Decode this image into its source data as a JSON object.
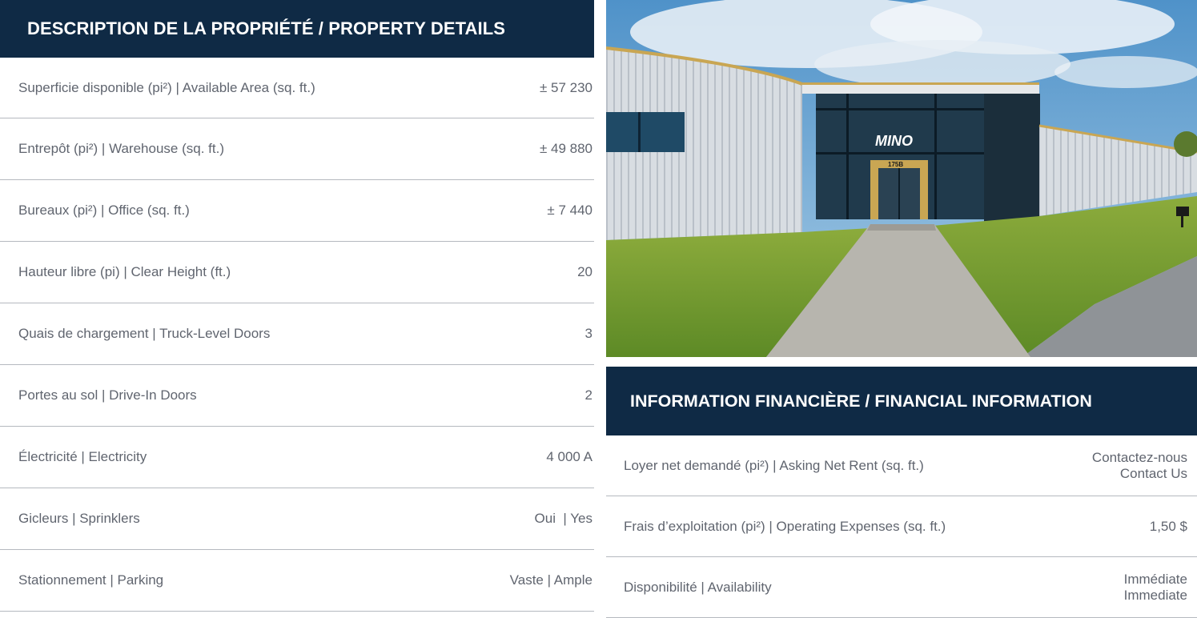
{
  "property": {
    "title": "DESCRIPTION DE LA PROPRIÉTÉ / PROPERTY DETAILS",
    "rows": [
      {
        "label": "Superficie disponible (pi²) | Available Area (sq. ft.)",
        "value": "± 57 230"
      },
      {
        "label": "Entrepôt (pi²) | Warehouse (sq. ft.)",
        "value": "± 49 880"
      },
      {
        "label": "Bureaux (pi²) | Office (sq. ft.)",
        "value": "± 7 440"
      },
      {
        "label": "Hauteur libre (pi) | Clear Height (ft.)",
        "value": "20"
      },
      {
        "label": "Quais de chargement | Truck-Level Doors",
        "value": "3"
      },
      {
        "label": "Portes au sol | Drive-In Doors",
        "value": "2"
      },
      {
        "label": "Électricité | Electricity",
        "value": "4 000 A"
      },
      {
        "label": "Gicleurs | Sprinklers",
        "value": "Oui  | Yes"
      },
      {
        "label": "Stationnement | Parking",
        "value": "Vaste | Ample"
      }
    ]
  },
  "photo": {
    "sign_text": "MINO",
    "door_number": "175B"
  },
  "financial": {
    "title": "INFORMATION FINANCIÈRE / FINANCIAL INFORMATION",
    "rows": [
      {
        "label": "Loyer net demandé (pi²) | Asking Net Rent (sq. ft.)",
        "value1": "Contactez-nous",
        "value2": "Contact Us"
      },
      {
        "label": "Frais d’exploitation (pi²) | Operating Expenses (sq. ft.)",
        "value1": "1,50 $",
        "value2": ""
      },
      {
        "label": "Disponibilité | Availability",
        "value1": "Immédiate",
        "value2": "Immediate"
      }
    ]
  },
  "colors": {
    "header_bg": "#0f2a45",
    "divider": "#b5b9bf",
    "text": "#60656f"
  }
}
